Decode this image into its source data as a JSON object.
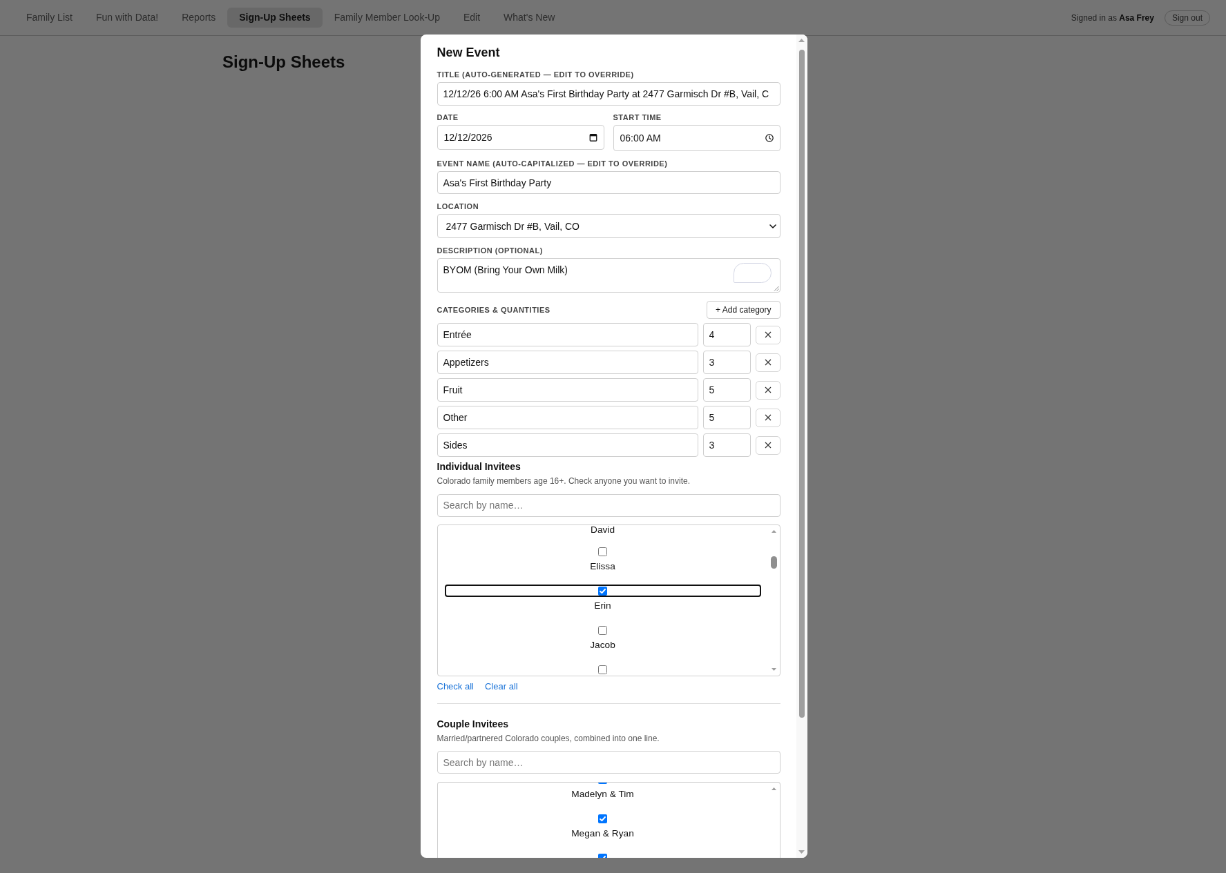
{
  "nav": {
    "items": [
      {
        "label": "Family List",
        "selected": false
      },
      {
        "label": "Fun with Data!",
        "selected": false
      },
      {
        "label": "Reports",
        "selected": false
      },
      {
        "label": "Sign-Up Sheets",
        "selected": true
      },
      {
        "label": "Family Member Look-Up",
        "selected": false
      },
      {
        "label": "Edit",
        "selected": false
      },
      {
        "label": "What's New",
        "selected": false
      }
    ],
    "signed_in": "Signed in as **Asa Frey**",
    "sign_out_button": "Sign out"
  },
  "page_heading": "Sign-Up Sheets",
  "modal": {
    "title": "New Event",
    "title_field": {
      "label": "TITLE (AUTO-GENERATED — EDIT TO OVERRIDE)",
      "value": "12/12/26 6:00 AM Asa's First Birthday Party at 2477 Garmisch Dr #B, Vail, C"
    },
    "date_field": {
      "label": "DATE",
      "value": "12/12/2026"
    },
    "start_time_field": {
      "label": "START TIME",
      "value": "06:00 AM"
    },
    "event_name_field": {
      "label": "EVENT NAME (AUTO-CAPITALIZED — EDIT TO OVERRIDE)",
      "value": "Asa's First Birthday Party"
    },
    "location_select": {
      "label": "LOCATION",
      "value": "2477 Garmisch Dr #B, Vail, CO"
    },
    "description_field": {
      "label": "DESCRIPTION (OPTIONAL)",
      "value": "BYOM (Bring Your Own Milk)"
    },
    "categories": {
      "label": "CATEGORIES & QUANTITIES",
      "add_button": "+ Add category",
      "rows": [
        {
          "name": "Entrée",
          "quantity": "4"
        },
        {
          "name": "Appetizers",
          "quantity": "3"
        },
        {
          "name": "Fruit",
          "quantity": "5"
        },
        {
          "name": "Other",
          "quantity": "5"
        },
        {
          "name": "Sides",
          "quantity": "3"
        }
      ]
    },
    "individual_invitees": {
      "heading": "Individual Invitees",
      "description": "Colorado family members age 16+. Check anyone you want to invite.",
      "search": {
        "placeholder": "Search by name…"
      },
      "items": [
        {
          "kind": "label",
          "label": "David"
        },
        {
          "kind": "full",
          "checked": false,
          "focused": false,
          "label": "Elissa"
        },
        {
          "kind": "full",
          "checked": true,
          "focused": true,
          "label": "Erin"
        },
        {
          "kind": "full",
          "checked": false,
          "focused": false,
          "label": "Jacob"
        },
        {
          "kind": "checkbox",
          "checked": false,
          "focused": false
        }
      ],
      "links": [
        "Check all",
        "Clear all"
      ]
    },
    "couple_invitees": {
      "heading": "Couple Invitees",
      "description": "Married/partnered Colorado couples, combined into one line.",
      "search": {
        "placeholder": "Search by name…"
      },
      "items": [
        {
          "kind": "full",
          "checked": true,
          "focused": false,
          "label": "Madelyn & Tim"
        },
        {
          "kind": "full",
          "checked": true,
          "focused": false,
          "label": "Megan & Ryan"
        },
        {
          "kind": "checkbox",
          "checked": true,
          "focused": false
        }
      ]
    }
  }
}
